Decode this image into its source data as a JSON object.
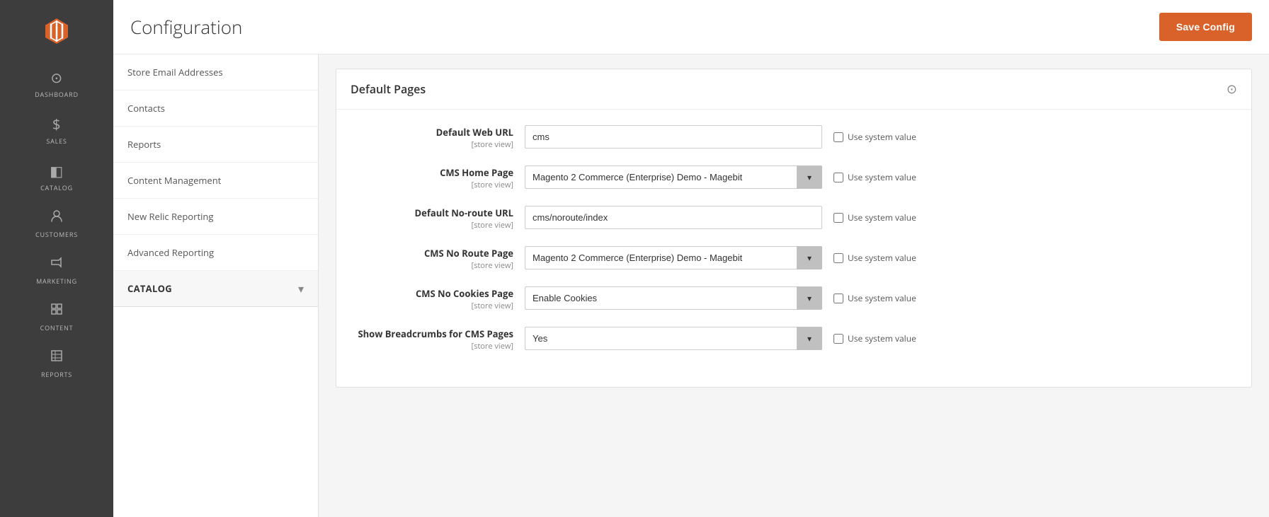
{
  "app": {
    "title": "Configuration",
    "save_button_label": "Save Config"
  },
  "sidebar": {
    "logo_alt": "Magento Logo",
    "nav_items": [
      {
        "id": "dashboard",
        "label": "DASHBOARD",
        "icon": "⊙"
      },
      {
        "id": "sales",
        "label": "SALES",
        "icon": "$"
      },
      {
        "id": "catalog",
        "label": "CATALOG",
        "icon": "◧"
      },
      {
        "id": "customers",
        "label": "CUSTOMERS",
        "icon": "👤"
      },
      {
        "id": "marketing",
        "label": "MARKETING",
        "icon": "📢"
      },
      {
        "id": "content",
        "label": "CONTENT",
        "icon": "▦"
      },
      {
        "id": "reports",
        "label": "REPORTS",
        "icon": "▤"
      }
    ]
  },
  "left_panel": {
    "menu_items": [
      {
        "id": "store-email",
        "label": "Store Email Addresses"
      },
      {
        "id": "contacts",
        "label": "Contacts"
      },
      {
        "id": "reports",
        "label": "Reports"
      },
      {
        "id": "content-management",
        "label": "Content Management"
      },
      {
        "id": "new-relic",
        "label": "New Relic Reporting"
      },
      {
        "id": "advanced-reporting",
        "label": "Advanced Reporting"
      }
    ],
    "catalog_section": {
      "label": "CATALOG",
      "chevron": "▾"
    }
  },
  "default_pages": {
    "section_title": "Default Pages",
    "collapse_icon": "⊙",
    "fields": [
      {
        "id": "default-web-url",
        "label": "Default Web URL",
        "scope": "[store view]",
        "type": "input",
        "value": "cms",
        "checkbox_label": "Use system value"
      },
      {
        "id": "cms-home-page",
        "label": "CMS Home Page",
        "scope": "[store view]",
        "type": "select",
        "value": "Magento 2 Commerce (Enterprise) Demo - Magebit",
        "checkbox_label": "Use system value"
      },
      {
        "id": "default-no-route-url",
        "label": "Default No-route URL",
        "scope": "[store view]",
        "type": "input",
        "value": "cms/noroute/index",
        "checkbox_label": "Use system value"
      },
      {
        "id": "cms-no-route-page",
        "label": "CMS No Route Page",
        "scope": "[store view]",
        "type": "select",
        "value": "Magento 2 Commerce (Enterprise) Demo - Magebit",
        "checkbox_label": "Use system value"
      },
      {
        "id": "cms-no-cookies-page",
        "label": "CMS No Cookies Page",
        "scope": "[store view]",
        "type": "select",
        "value": "Enable Cookies",
        "checkbox_label": "Use system value"
      },
      {
        "id": "show-breadcrumbs",
        "label": "Show Breadcrumbs for CMS Pages",
        "scope": "[store view]",
        "type": "select",
        "value": "Yes",
        "checkbox_label": "Use system value"
      }
    ]
  },
  "colors": {
    "accent": "#d9622b",
    "sidebar_bg": "#3d3d3d",
    "nav_text": "#bbb"
  }
}
